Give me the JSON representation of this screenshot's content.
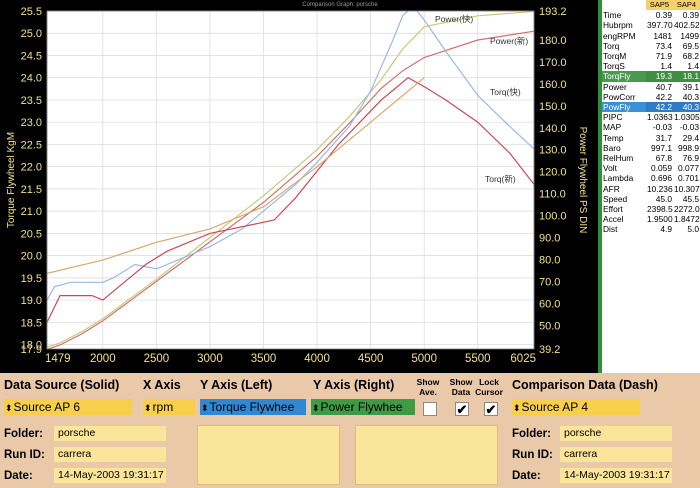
{
  "chart_data": {
    "type": "line",
    "title": "Comparison Graph: porsche",
    "xlabel": "",
    "ylabel_left": "Torque Flywheel KgM",
    "ylabel_right": "Power Flywheel PS DIN",
    "xlim": [
      1479,
      6025
    ],
    "ylim_left": [
      17.9,
      25.5
    ],
    "ylim_right": [
      39.2,
      193.2
    ],
    "x_ticks": [
      "1479",
      "2000",
      "2500",
      "3000",
      "3500",
      "4000",
      "4500",
      "5000",
      "5500",
      "6025"
    ],
    "y_left_ticks": [
      "25.5",
      "25.0",
      "24.5",
      "24.0",
      "23.5",
      "23.0",
      "22.5",
      "22.0",
      "21.5",
      "21.0",
      "20.5",
      "20.0",
      "19.5",
      "19.0",
      "18.5",
      "18.0",
      "17.9"
    ],
    "y_right_ticks": [
      "193.2",
      "180.0",
      "170.0",
      "160.0",
      "150.0",
      "140.0",
      "130.0",
      "120.0",
      "110.0",
      "100.0",
      "90.0",
      "80.0",
      "70.0",
      "60.0",
      "50.0",
      "39.2"
    ],
    "grid": true,
    "series": [
      {
        "name": "Power(快)",
        "axis": "right",
        "color": "#c9c97a",
        "x": [
          1479,
          1600,
          1800,
          2000,
          2500,
          3000,
          3500,
          4000,
          4300,
          4600,
          4800,
          5000,
          5500,
          6025
        ],
        "y": [
          40,
          42,
          47,
          53,
          71,
          90,
          109,
          130,
          145,
          162,
          176,
          186,
          191,
          193
        ]
      },
      {
        "name": "Power(新)",
        "axis": "right",
        "color": "#d07070",
        "x": [
          1479,
          1600,
          1800,
          2000,
          2500,
          3000,
          3500,
          4000,
          4300,
          4600,
          4800,
          5000,
          5500,
          6025
        ],
        "y": [
          39,
          41,
          46,
          52,
          70,
          88,
          106,
          127,
          142,
          158,
          166,
          172,
          180,
          184
        ]
      },
      {
        "name": "Torq(快)",
        "axis": "left",
        "color": "#9ab8e8",
        "x": [
          1479,
          1550,
          1700,
          1900,
          2000,
          2100,
          2300,
          2500,
          2800,
          3000,
          3300,
          3600,
          3800,
          4000,
          4300,
          4500,
          4700,
          4800,
          4900,
          5000,
          5200,
          5500,
          5800,
          6025
        ],
        "y": [
          19.0,
          19.3,
          19.4,
          19.4,
          19.4,
          19.5,
          19.8,
          19.7,
          20.0,
          20.2,
          20.6,
          21.2,
          21.6,
          22.1,
          22.9,
          23.7,
          24.8,
          25.4,
          25.6,
          25.3,
          24.6,
          23.6,
          22.9,
          22.4
        ]
      },
      {
        "name": "Torq(新)",
        "axis": "left",
        "color": "#c84a5a",
        "x": [
          1479,
          1520,
          1600,
          1800,
          1900,
          2000,
          2100,
          2200,
          2400,
          2600,
          2800,
          3000,
          3200,
          3400,
          3600,
          3800,
          4000,
          4200,
          4400,
          4600,
          4750,
          4850,
          5000,
          5200,
          5500,
          5800,
          6025
        ],
        "y": [
          18.5,
          18.7,
          19.1,
          19.1,
          19.1,
          19.0,
          19.2,
          19.4,
          19.8,
          20.1,
          20.3,
          20.5,
          20.6,
          20.7,
          20.8,
          21.3,
          21.9,
          22.5,
          23.0,
          23.5,
          23.8,
          24.0,
          23.8,
          23.5,
          23.0,
          22.3,
          21.6
        ]
      },
      {
        "name": "",
        "axis": "left",
        "color": "#d8a86a",
        "x": [
          1479,
          2000,
          2500,
          3000,
          3500,
          4000,
          4500,
          5000
        ],
        "y": [
          19.6,
          19.9,
          20.3,
          20.6,
          21.1,
          22.0,
          23.0,
          24.0
        ]
      }
    ]
  },
  "data_panel": {
    "headers": [
      "SAP5",
      "SAP4"
    ],
    "rows": [
      {
        "label": "Time",
        "v1": "0.39",
        "v2": "0.39",
        "hl": ""
      },
      {
        "label": "Hubrpm",
        "v1": "397.70",
        "v2": "402.52",
        "hl": ""
      },
      {
        "label": "engRPM",
        "v1": "1481",
        "v2": "1499",
        "hl": ""
      },
      {
        "label": "Torq",
        "v1": "73.4",
        "v2": "69.5",
        "hl": ""
      },
      {
        "label": "TorqM",
        "v1": "71.9",
        "v2": "68.2",
        "hl": ""
      },
      {
        "label": "TorqS",
        "v1": "1.4",
        "v2": "1.4",
        "hl": ""
      },
      {
        "label": "TorqFly",
        "v1": "19.3",
        "v2": "18.1",
        "hl": "green"
      },
      {
        "label": "Power",
        "v1": "40.7",
        "v2": "39.1",
        "hl": ""
      },
      {
        "label": "PowCorr",
        "v1": "42.2",
        "v2": "40.3",
        "hl": ""
      },
      {
        "label": "PowFly",
        "v1": "42.2",
        "v2": "40.3",
        "hl": "blue"
      },
      {
        "label": "PIPC",
        "v1": "1.03631",
        "v2": "1.03054",
        "hl": ""
      },
      {
        "label": "MAP",
        "v1": "-0.03",
        "v2": "-0.03",
        "hl": ""
      },
      {
        "label": "Temp",
        "v1": "31.7",
        "v2": "29.4",
        "hl": ""
      },
      {
        "label": "Baro",
        "v1": "997.1",
        "v2": "998.9",
        "hl": ""
      },
      {
        "label": "RelHum",
        "v1": "67.8",
        "v2": "76.9",
        "hl": ""
      },
      {
        "label": "Volt",
        "v1": "0.059",
        "v2": "0.077",
        "hl": ""
      },
      {
        "label": "Lambda",
        "v1": "0.696",
        "v2": "0.701",
        "hl": ""
      },
      {
        "label": "AFR",
        "v1": "10.236",
        "v2": "10.307",
        "hl": ""
      },
      {
        "label": "Speed",
        "v1": "45.0",
        "v2": "45.5",
        "hl": ""
      },
      {
        "label": "Effort",
        "v1": "2398.5",
        "v2": "2272.0",
        "hl": ""
      },
      {
        "label": "Accel",
        "v1": "1.9500",
        "v2": "1.8472",
        "hl": ""
      },
      {
        "label": "Dist",
        "v1": "4.9",
        "v2": "5.0",
        "hl": ""
      }
    ]
  },
  "controls": {
    "data_source_label": "Data Source (Solid)",
    "x_axis_label": "X Axis",
    "y_left_label": "Y Axis (Left)",
    "y_right_label": "Y Axis (Right)",
    "show_ave_label_1": "Show",
    "show_ave_label_2": "Ave.",
    "show_data_label_1": "Show",
    "show_data_label_2": "Data",
    "lock_cursor_label_1": "Lock",
    "lock_cursor_label_2": "Cursor",
    "comparison_label": "Comparison Data (Dash)",
    "data_source_value": "Source AP 6",
    "x_axis_value": "rpm",
    "y_left_value": "Torque Flywhee",
    "y_right_value": "Power Flywhee",
    "comparison_value": "Source AP 4",
    "check_mark": "✔",
    "arrow": "⬍"
  },
  "left_info": {
    "folder_label": "Folder:",
    "folder_value": "porsche",
    "run_label": "Run ID:",
    "run_value": "carrera",
    "date_label": "Date:",
    "date_value": "14-May-2003  19:31:17"
  },
  "right_info": {
    "folder_label": "Folder:",
    "folder_value": "porsche",
    "run_label": "Run ID:",
    "run_value": "carrera",
    "date_label": "Date:",
    "date_value": "14-May-2003  19:31:17"
  },
  "colors": {
    "panel_bg": "#e9c9a8",
    "field_bg": "#fbe59a",
    "select_yellow": "#f7cf4a",
    "select_blue": "#2e88d4",
    "select_green": "#3f9a45",
    "axis_text": "#f0e08a"
  }
}
